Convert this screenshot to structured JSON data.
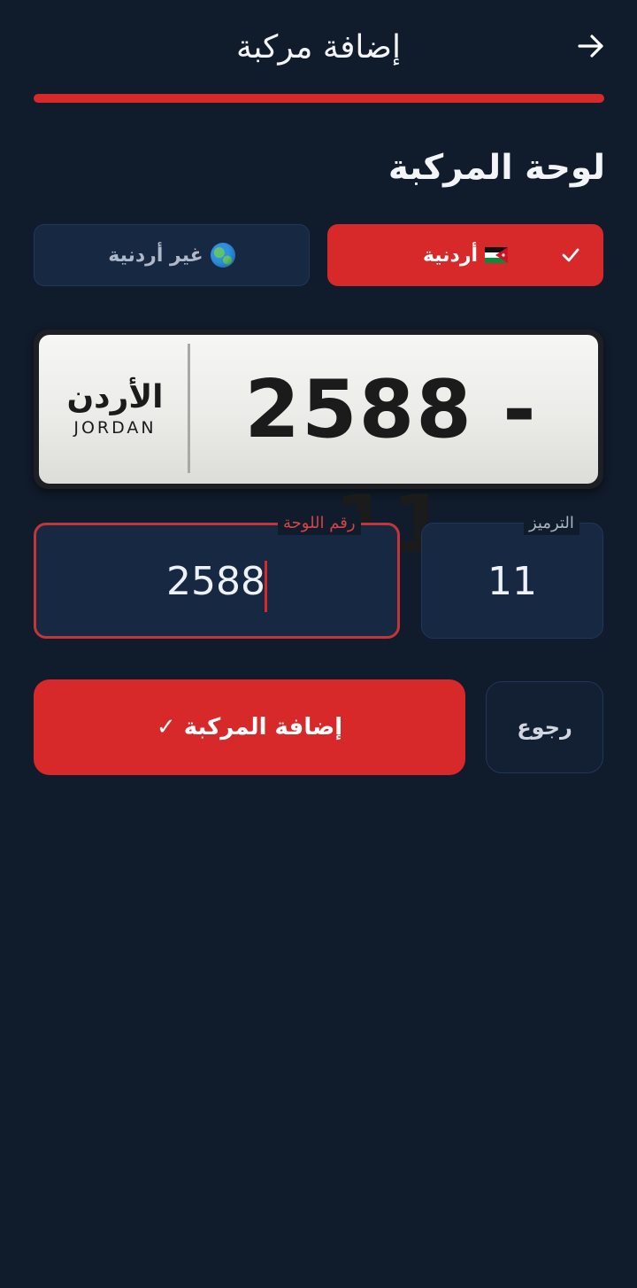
{
  "header": {
    "title": "إضافة مركبة",
    "back_icon": "arrow-right-icon"
  },
  "progress": {
    "fraction": 1.0,
    "color": "#d7282a"
  },
  "section": {
    "title": "لوحة المركبة"
  },
  "plate_type": {
    "options": [
      {
        "label": "أردنية",
        "icon": "jordan-flag-icon",
        "selected": true
      },
      {
        "label": "غير أردنية",
        "icon": "globe-icon",
        "selected": false
      }
    ]
  },
  "plate_preview": {
    "number": "2588 - 11",
    "country_ar": "الأردن",
    "country_en": "JORDAN"
  },
  "fields": {
    "plate_number": {
      "label": "رقم اللوحة",
      "value": "2588"
    },
    "code": {
      "label": "الترميز",
      "value": "11"
    }
  },
  "buttons": {
    "add": "إضافة المركبة ✓",
    "back": "رجوع"
  },
  "colors": {
    "background": "#101b2b",
    "accent": "#d7282a",
    "card": "#172842"
  }
}
